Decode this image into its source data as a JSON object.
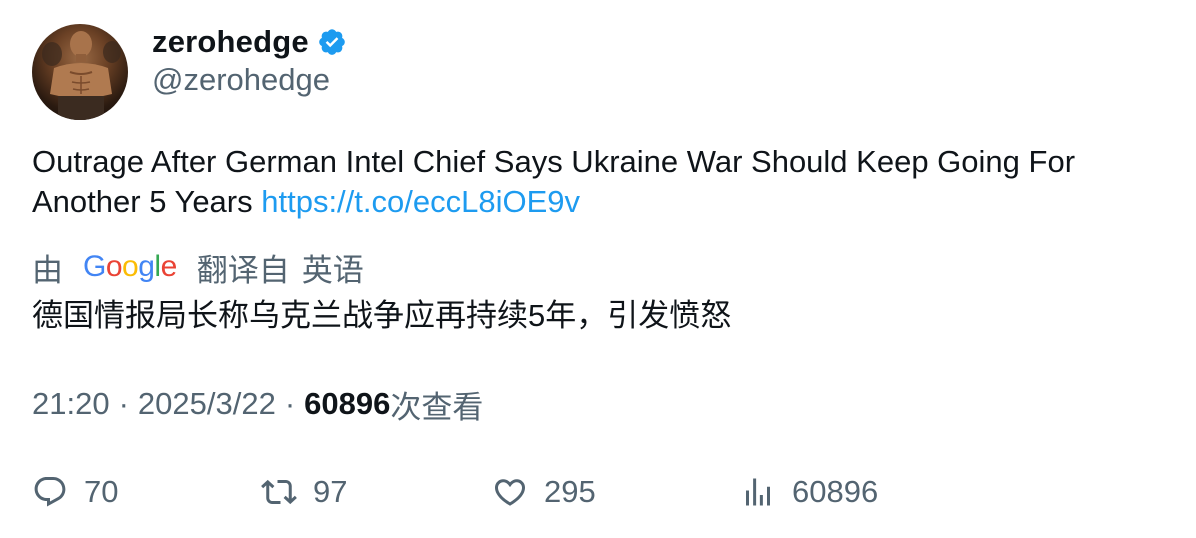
{
  "author": {
    "display_name": "zerohedge",
    "handle": "@zerohedge",
    "verified": true
  },
  "tweet": {
    "text": "Outrage After German Intel Chief Says Ukraine War Should Keep Going For Another 5 Years ",
    "link": "https://t.co/eccL8iOE9v"
  },
  "translation": {
    "by_label": "由",
    "provider": "Google",
    "from_label": "翻译自",
    "source_language": "英语",
    "translated_text": "德国情报局长称乌克兰战争应再持续5年，引发愤怒"
  },
  "meta": {
    "time": "21:20",
    "separator": "·",
    "date": "2025/3/22",
    "views_count": "60896",
    "views_label": "次查看"
  },
  "actions": {
    "replies": "70",
    "retweets": "97",
    "likes": "295",
    "views": "60896"
  },
  "colors": {
    "link": "#1d9bf0",
    "secondary_text": "#536471",
    "primary_text": "#0f1419",
    "verified_badge": "#1d9bf0"
  },
  "icons": [
    "verified-badge-icon",
    "reply-icon",
    "retweet-icon",
    "like-icon",
    "views-icon"
  ]
}
